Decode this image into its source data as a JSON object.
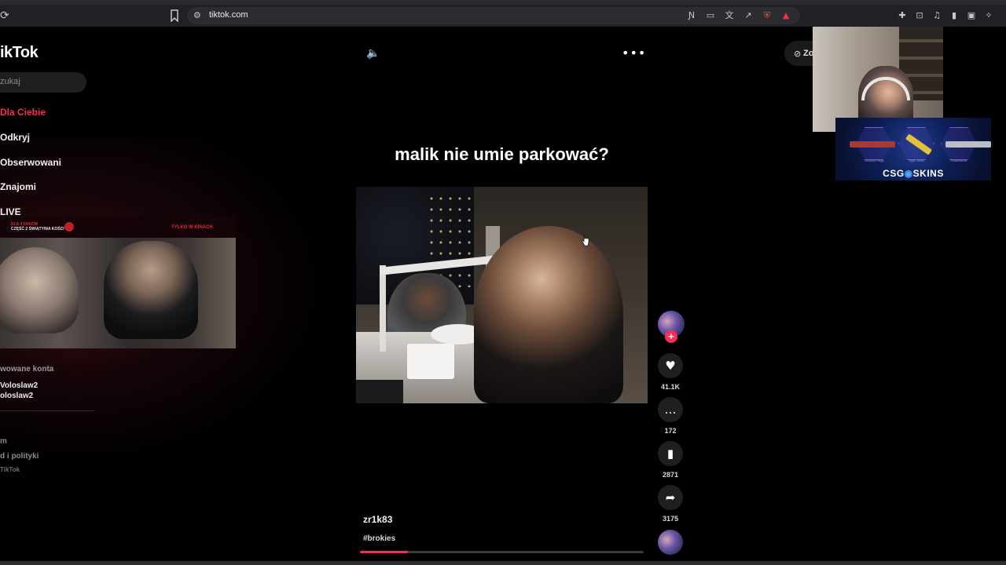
{
  "browser": {
    "url": "tiktok.com",
    "reload_icon": "reload-icon",
    "bookmark_icon": "bookmark-icon"
  },
  "sidebar": {
    "logo": "ikTok",
    "search_placeholder": "zukaj",
    "nav": [
      {
        "label": "Dla Ciebie",
        "active": true
      },
      {
        "label": "Odkryj",
        "active": false
      },
      {
        "label": "Obserwowani",
        "active": false
      },
      {
        "label": "Znajomi",
        "active": false
      },
      {
        "label": "LIVE",
        "active": false
      }
    ],
    "followed_title": "wowane konta",
    "followed_accounts": [
      "Voloslaw2",
      "oloslaw2"
    ],
    "footer_links": [
      "m",
      "d i polityki"
    ],
    "copyright": "TikTok"
  },
  "overlay_video": {
    "badge_line1": "DLA 4 FANÓW",
    "badge_line2": "CZĘŚĆ 2 ŚWIĄTYNIA KOŚCI",
    "tag": "TYLKO W KINACH"
  },
  "player": {
    "caption": "malik nie umie parkować?",
    "author": "zr1k83",
    "hashtag": "#brokies",
    "progress": 0.17,
    "actions": {
      "likes": "41.1K",
      "comments": "172",
      "saves": "2871",
      "shares": "3175"
    }
  },
  "right_overlay": {
    "zone_label": "Zo",
    "csg_brand_left": "CSG",
    "csg_brand_right": "SKINS",
    "csg_items": [
      "Crimson Rage",
      "Tiger Tooth",
      "Phantasma"
    ]
  },
  "colors": {
    "accent": "#fe2c55",
    "background": "#000000",
    "chrome": "#202124"
  }
}
